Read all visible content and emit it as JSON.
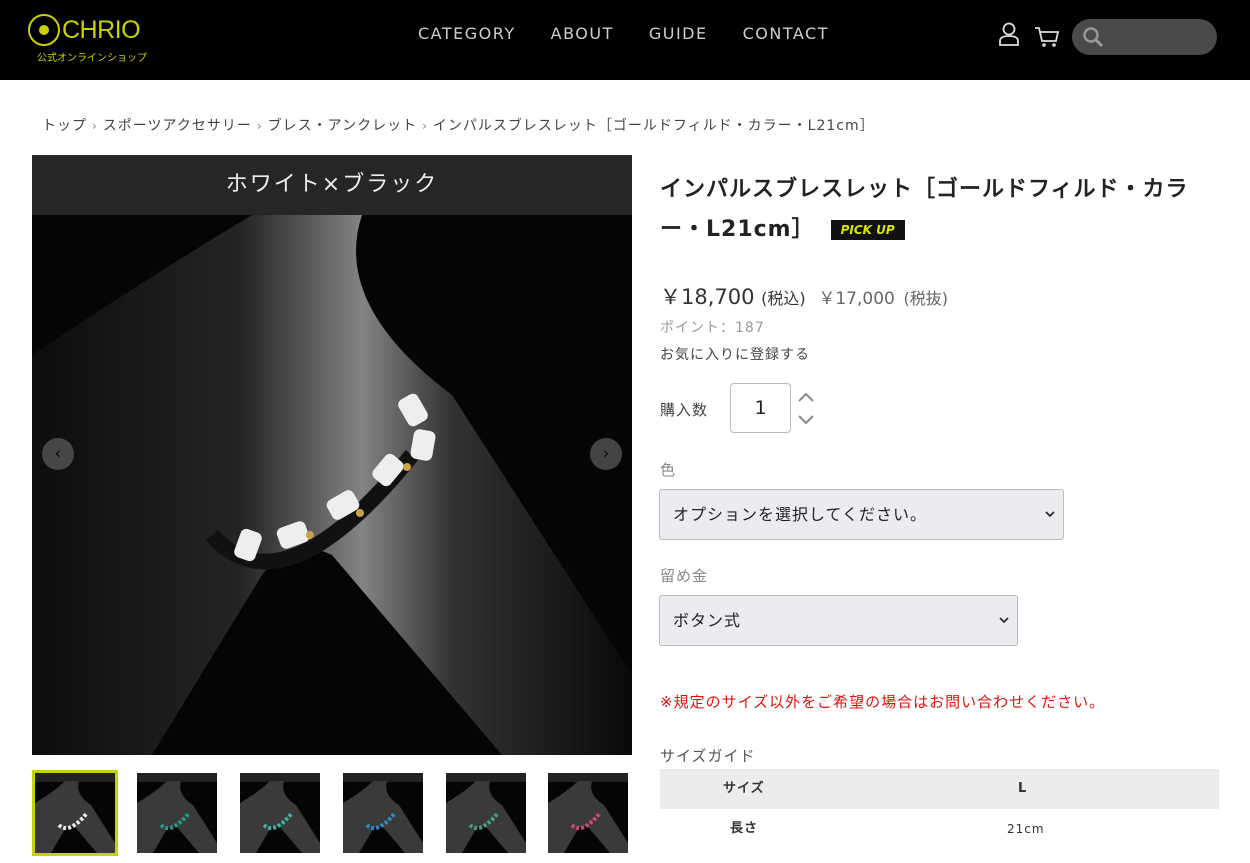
{
  "header": {
    "logo_text": "CHRIO",
    "logo_sub": "公式オンラインショップ",
    "nav": [
      "CATEGORY",
      "ABOUT",
      "GUIDE",
      "CONTACT"
    ],
    "icons": [
      "user-icon",
      "cart-icon",
      "search-icon"
    ],
    "search_placeholder": ""
  },
  "breadcrumb": [
    "トップ",
    "スポーツアクセサリー",
    "ブレス・アンクレット",
    "インパルスブレスレット［ゴールドフィルド・カラー・L21cm］"
  ],
  "gallery": {
    "banner": "ホワイト×ブラック",
    "prev_label": "‹",
    "next_label": "›",
    "thumb_count": 6,
    "thumb_accents": [
      "#e8e8e8",
      "#2a9a8a",
      "#3fb4a8",
      "#2a8fc0",
      "#4a9c8a",
      "#d04a78"
    ]
  },
  "product": {
    "title": "インパルスブレスレット［ゴールドフィルド・カラー・L21cm］",
    "badge": "PICK UP",
    "price_incl": "￥18,700",
    "price_incl_note": "(税込)",
    "price_excl": "￥17,000",
    "price_excl_note": "(税抜)",
    "points": "ポイント：187",
    "favorite": "お気に入りに登録する",
    "qty_label": "購入数",
    "qty_value": "1",
    "color_label": "色",
    "color_select": "オプションを選択してください。",
    "clasp_label": "留め金",
    "clasp_select": "ボタン式",
    "notice": "※規定のサイズ以外をご希望の場合はお問い合わせください。",
    "size_guide": "サイズガイド",
    "size_table": {
      "head": [
        "サイズ",
        "L"
      ],
      "rows": [
        [
          "長さ",
          "21cm"
        ]
      ]
    }
  },
  "colors": {
    "accent": "#c5d400",
    "notice": "#e0140b",
    "header_bg": "#000000"
  }
}
